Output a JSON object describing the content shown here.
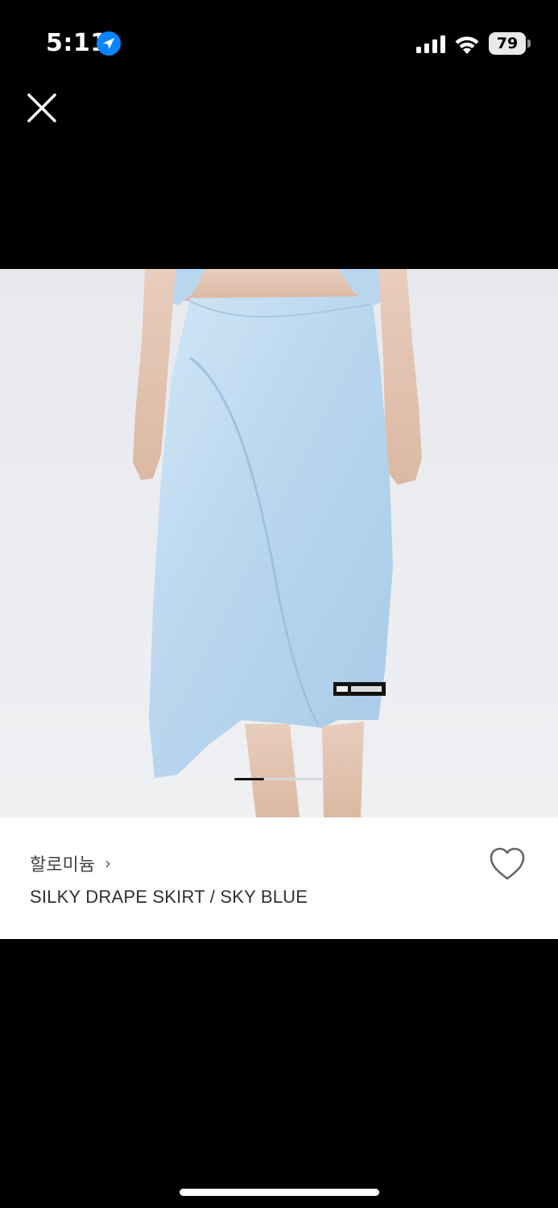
{
  "status_bar": {
    "time": "5:11",
    "battery_level": "79",
    "icons": [
      "location-arrow-icon",
      "cellular-signal-icon",
      "wifi-icon",
      "battery-icon"
    ]
  },
  "header": {
    "close_icon": "close-icon"
  },
  "gallery": {
    "image": "sky blue satin asymmetric skirt on model",
    "label_tag_text": "SILKY DRAPE SKIRT",
    "current_slide_fraction": 0.33
  },
  "product": {
    "brand": "할로미늄",
    "brand_chevron": "›",
    "name": "SILKY DRAPE SKIRT / SKY BLUE",
    "wishlist_icon": "heart-outline-icon"
  },
  "colors": {
    "accent_location": "#0a84ff",
    "skirt": "#b8d6ef",
    "background": "#000000"
  }
}
